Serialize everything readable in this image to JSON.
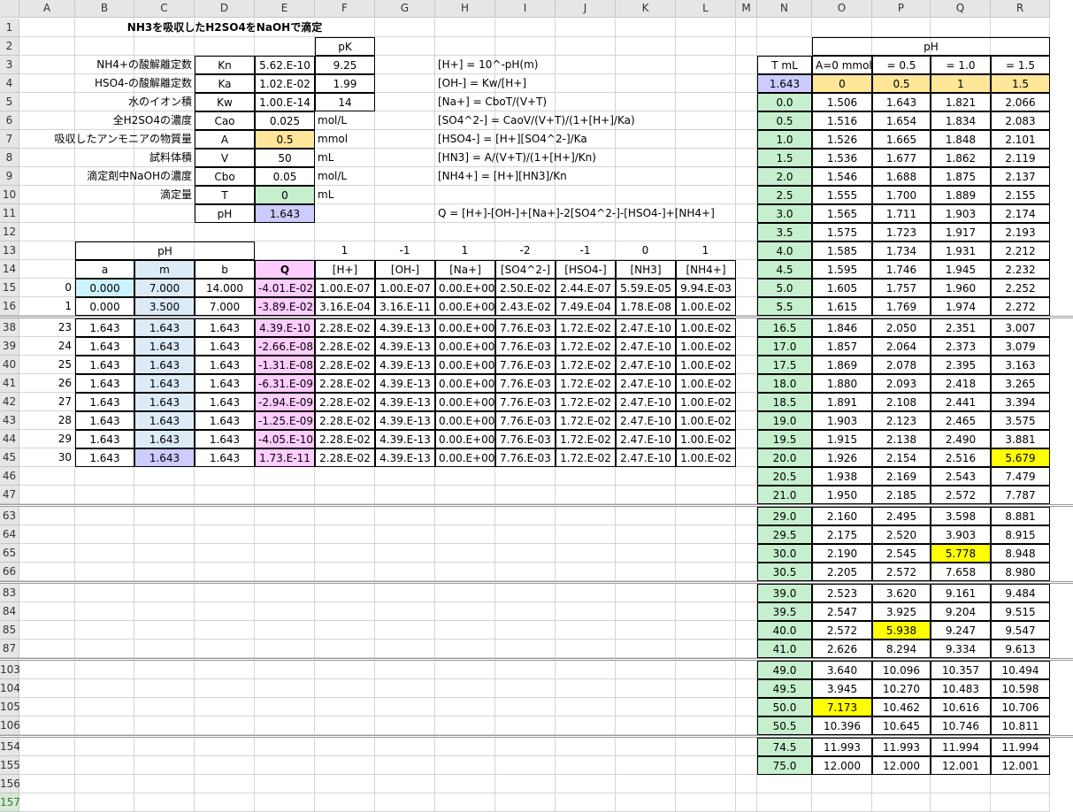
{
  "columns": [
    "A",
    "B",
    "C",
    "D",
    "E",
    "F",
    "G",
    "H",
    "I",
    "J",
    "K",
    "L",
    "M",
    "N",
    "O",
    "P",
    "Q",
    "R"
  ],
  "colors": {
    "yellow_input": "#FFE699",
    "green": "#C6EFCE",
    "lavender": "#CCCCFF",
    "light_blue_a": "#CCF2FF",
    "light_blue_m": "#DDEBF7",
    "pink": "#FFCCFF",
    "highlight": "#FFFF00"
  },
  "title": "NH3を吸収したH2SO4をNaOHで滴定",
  "params": {
    "pk_header": "pK",
    "rows": [
      {
        "label": "NH4+の酸解離定数",
        "sym": "Kn",
        "val": "5.62.E-10",
        "pk": "9.25"
      },
      {
        "label": "HSO4-の酸解離定数",
        "sym": "Ka",
        "val": "1.02.E-02",
        "pk": "1.99"
      },
      {
        "label": "水のイオン積",
        "sym": "Kw",
        "val": "1.00.E-14",
        "pk": "14"
      },
      {
        "label": "全H2SO4の濃度",
        "sym": "Cao",
        "val": "0.025",
        "unit": "mol/L"
      },
      {
        "label": "吸収したアンモニアの物質量",
        "sym": "A",
        "val": "0.5",
        "unit": "mmol"
      },
      {
        "label": "試料体積",
        "sym": "V",
        "val": "50",
        "unit": "mL"
      },
      {
        "label": "滴定剤中NaOHの濃度",
        "sym": "Cbo",
        "val": "0.05",
        "unit": "mol/L"
      },
      {
        "label": "滴定量",
        "sym": "T",
        "val": "0",
        "unit": "mL"
      },
      {
        "label": "",
        "sym": "pH",
        "val": "1.643",
        "unit": ""
      }
    ]
  },
  "formulas": [
    "[H+] = 10^-pH(m)",
    "[OH-] = Kw/[H+]",
    "[Na+] = CboT/(V+T)",
    "[SO4^2-] = CaoV/(V+T)/(1+[H+]/Ka)",
    "[HSO4-] = [H+][SO4^2-]/Ka",
    "[HN3] = A/(V+T)/(1+[H+]/Kn)",
    "[NH4+] = [H+][HN3]/Kn",
    "Q = [H+]-[OH-]+[Na+]-2[SO4^2-]-[HSO4-]+[NH4+]"
  ],
  "bisect": {
    "ph_header": "pH",
    "coef": [
      "1",
      "-1",
      "1",
      "-2",
      "-1",
      "0",
      "1"
    ],
    "headers": [
      "a",
      "m",
      "b",
      "Q",
      "[H+]",
      "[OH-]",
      "[Na+]",
      "[SO4^2-]",
      "[HSO4-]",
      "[NH3]",
      "[NH4+]"
    ],
    "rows": [
      {
        "i": "0",
        "a": "0.000",
        "m": "7.000",
        "b": "14.000",
        "q": "-4.01.E-02",
        "h": "1.00.E-07",
        "oh": "1.00.E-07",
        "na": "0.00.E+00",
        "so4": "2.50.E-02",
        "hso4": "2.44.E-07",
        "nh3": "5.59.E-05",
        "nh4": "9.94.E-03"
      },
      {
        "i": "1",
        "a": "0.000",
        "m": "3.500",
        "b": "7.000",
        "q": "-3.89.E-02",
        "h": "3.16.E-04",
        "oh": "3.16.E-11",
        "na": "0.00.E+00",
        "so4": "2.43.E-02",
        "hso4": "7.49.E-04",
        "nh3": "1.78.E-08",
        "nh4": "1.00.E-02"
      },
      {
        "i": "23",
        "a": "1.643",
        "m": "1.643",
        "b": "1.643",
        "q": "4.39.E-10",
        "h": "2.28.E-02",
        "oh": "4.39.E-13",
        "na": "0.00.E+00",
        "so4": "7.76.E-03",
        "hso4": "1.72.E-02",
        "nh3": "2.47.E-10",
        "nh4": "1.00.E-02"
      },
      {
        "i": "24",
        "a": "1.643",
        "m": "1.643",
        "b": "1.643",
        "q": "-2.66.E-08",
        "h": "2.28.E-02",
        "oh": "4.39.E-13",
        "na": "0.00.E+00",
        "so4": "7.76.E-03",
        "hso4": "1.72.E-02",
        "nh3": "2.47.E-10",
        "nh4": "1.00.E-02"
      },
      {
        "i": "25",
        "a": "1.643",
        "m": "1.643",
        "b": "1.643",
        "q": "-1.31.E-08",
        "h": "2.28.E-02",
        "oh": "4.39.E-13",
        "na": "0.00.E+00",
        "so4": "7.76.E-03",
        "hso4": "1.72.E-02",
        "nh3": "2.47.E-10",
        "nh4": "1.00.E-02"
      },
      {
        "i": "26",
        "a": "1.643",
        "m": "1.643",
        "b": "1.643",
        "q": "-6.31.E-09",
        "h": "2.28.E-02",
        "oh": "4.39.E-13",
        "na": "0.00.E+00",
        "so4": "7.76.E-03",
        "hso4": "1.72.E-02",
        "nh3": "2.47.E-10",
        "nh4": "1.00.E-02"
      },
      {
        "i": "27",
        "a": "1.643",
        "m": "1.643",
        "b": "1.643",
        "q": "-2.94.E-09",
        "h": "2.28.E-02",
        "oh": "4.39.E-13",
        "na": "0.00.E+00",
        "so4": "7.76.E-03",
        "hso4": "1.72.E-02",
        "nh3": "2.47.E-10",
        "nh4": "1.00.E-02"
      },
      {
        "i": "28",
        "a": "1.643",
        "m": "1.643",
        "b": "1.643",
        "q": "-1.25.E-09",
        "h": "2.28.E-02",
        "oh": "4.39.E-13",
        "na": "0.00.E+00",
        "so4": "7.76.E-03",
        "hso4": "1.72.E-02",
        "nh3": "2.47.E-10",
        "nh4": "1.00.E-02"
      },
      {
        "i": "29",
        "a": "1.643",
        "m": "1.643",
        "b": "1.643",
        "q": "-4.05.E-10",
        "h": "2.28.E-02",
        "oh": "4.39.E-13",
        "na": "0.00.E+00",
        "so4": "7.76.E-03",
        "hso4": "1.72.E-02",
        "nh3": "2.47.E-10",
        "nh4": "1.00.E-02"
      },
      {
        "i": "30",
        "a": "1.643",
        "m": "1.643",
        "b": "1.643",
        "q": "1.73.E-11",
        "h": "2.28.E-02",
        "oh": "4.39.E-13",
        "na": "0.00.E+00",
        "so4": "7.76.E-03",
        "hso4": "1.72.E-02",
        "nh3": "2.47.E-10",
        "nh4": "1.00.E-02"
      }
    ]
  },
  "ph_table": {
    "header": "pH",
    "col_headers": [
      "T mL",
      "A=0 mmol",
      "= 0.5",
      "= 1.0",
      "= 1.5"
    ],
    "top_row": [
      "1.643",
      "0",
      "0.5",
      "1",
      "1.5"
    ],
    "rows": [
      {
        "t": "0.0",
        "v": [
          "1.506",
          "1.643",
          "1.821",
          "2.066"
        ]
      },
      {
        "t": "0.5",
        "v": [
          "1.516",
          "1.654",
          "1.834",
          "2.083"
        ]
      },
      {
        "t": "1.0",
        "v": [
          "1.526",
          "1.665",
          "1.848",
          "2.101"
        ]
      },
      {
        "t": "1.5",
        "v": [
          "1.536",
          "1.677",
          "1.862",
          "2.119"
        ]
      },
      {
        "t": "2.0",
        "v": [
          "1.546",
          "1.688",
          "1.875",
          "2.137"
        ]
      },
      {
        "t": "2.5",
        "v": [
          "1.555",
          "1.700",
          "1.889",
          "2.155"
        ]
      },
      {
        "t": "3.0",
        "v": [
          "1.565",
          "1.711",
          "1.903",
          "2.174"
        ]
      },
      {
        "t": "3.5",
        "v": [
          "1.575",
          "1.723",
          "1.917",
          "2.193"
        ]
      },
      {
        "t": "4.0",
        "v": [
          "1.585",
          "1.734",
          "1.931",
          "2.212"
        ]
      },
      {
        "t": "4.5",
        "v": [
          "1.595",
          "1.746",
          "1.945",
          "2.232"
        ]
      },
      {
        "t": "5.0",
        "v": [
          "1.605",
          "1.757",
          "1.960",
          "2.252"
        ]
      },
      {
        "t": "5.5",
        "v": [
          "1.615",
          "1.769",
          "1.974",
          "2.272"
        ]
      },
      {
        "t": "16.5",
        "v": [
          "1.846",
          "2.050",
          "2.351",
          "3.007"
        ]
      },
      {
        "t": "17.0",
        "v": [
          "1.857",
          "2.064",
          "2.373",
          "3.079"
        ]
      },
      {
        "t": "17.5",
        "v": [
          "1.869",
          "2.078",
          "2.395",
          "3.163"
        ]
      },
      {
        "t": "18.0",
        "v": [
          "1.880",
          "2.093",
          "2.418",
          "3.265"
        ]
      },
      {
        "t": "18.5",
        "v": [
          "1.891",
          "2.108",
          "2.441",
          "3.394"
        ]
      },
      {
        "t": "19.0",
        "v": [
          "1.903",
          "2.123",
          "2.465",
          "3.575"
        ]
      },
      {
        "t": "19.5",
        "v": [
          "1.915",
          "2.138",
          "2.490",
          "3.881"
        ]
      },
      {
        "t": "20.0",
        "v": [
          "1.926",
          "2.154",
          "2.516",
          "5.679"
        ],
        "hl": 3
      },
      {
        "t": "20.5",
        "v": [
          "1.938",
          "2.169",
          "2.543",
          "7.479"
        ]
      },
      {
        "t": "21.0",
        "v": [
          "1.950",
          "2.185",
          "2.572",
          "7.787"
        ]
      },
      {
        "t": "29.0",
        "v": [
          "2.160",
          "2.495",
          "3.598",
          "8.881"
        ]
      },
      {
        "t": "29.5",
        "v": [
          "2.175",
          "2.520",
          "3.903",
          "8.915"
        ]
      },
      {
        "t": "30.0",
        "v": [
          "2.190",
          "2.545",
          "5.778",
          "8.948"
        ],
        "hl": 2
      },
      {
        "t": "30.5",
        "v": [
          "2.205",
          "2.572",
          "7.658",
          "8.980"
        ]
      },
      {
        "t": "39.0",
        "v": [
          "2.523",
          "3.620",
          "9.161",
          "9.484"
        ]
      },
      {
        "t": "39.5",
        "v": [
          "2.547",
          "3.925",
          "9.204",
          "9.515"
        ]
      },
      {
        "t": "40.0",
        "v": [
          "2.572",
          "5.938",
          "9.247",
          "9.547"
        ],
        "hl": 1
      },
      {
        "t": "41.0",
        "v": [
          "2.626",
          "8.294",
          "9.334",
          "9.613"
        ]
      },
      {
        "t": "49.0",
        "v": [
          "3.640",
          "10.096",
          "10.357",
          "10.494"
        ]
      },
      {
        "t": "49.5",
        "v": [
          "3.945",
          "10.270",
          "10.483",
          "10.598"
        ]
      },
      {
        "t": "50.0",
        "v": [
          "7.173",
          "10.462",
          "10.616",
          "10.706"
        ],
        "hl": 0
      },
      {
        "t": "50.5",
        "v": [
          "10.396",
          "10.645",
          "10.746",
          "10.811"
        ]
      },
      {
        "t": "74.5",
        "v": [
          "11.993",
          "11.993",
          "11.994",
          "11.994"
        ]
      },
      {
        "t": "75.0",
        "v": [
          "12.000",
          "12.000",
          "12.001",
          "12.001"
        ]
      }
    ]
  },
  "row_numbers": [
    "1",
    "2",
    "3",
    "4",
    "5",
    "6",
    "7",
    "8",
    "9",
    "10",
    "11",
    "12",
    "13",
    "14",
    "15",
    "16",
    "38",
    "39",
    "40",
    "41",
    "42",
    "43",
    "44",
    "45",
    "46",
    "47",
    "63",
    "64",
    "65",
    "66",
    "83",
    "84",
    "85",
    "87",
    "103",
    "104",
    "105",
    "106",
    "154",
    "155",
    "156",
    "157"
  ]
}
